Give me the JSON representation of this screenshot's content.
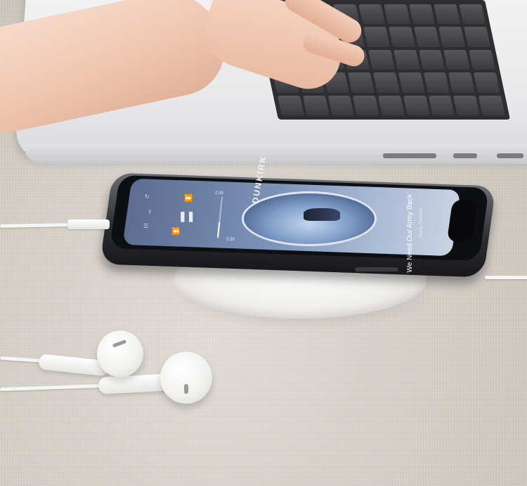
{
  "scene": {
    "description_items": [
      "laptop",
      "hand",
      "smartphone",
      "wireless-charger",
      "earphones",
      "usb-cable"
    ]
  },
  "phone_screen": {
    "song_title": "We Need Our Army Back",
    "song_artist": "Hans Zimmer",
    "album_art_text": "DUNKIRK",
    "time_elapsed": "2:06",
    "time_total": "5:36",
    "progress": 0.38
  },
  "colors": {
    "screen_accent": "#7c93b8",
    "device_white": "#f5f5f3",
    "cloth": "#d7d2cb"
  }
}
